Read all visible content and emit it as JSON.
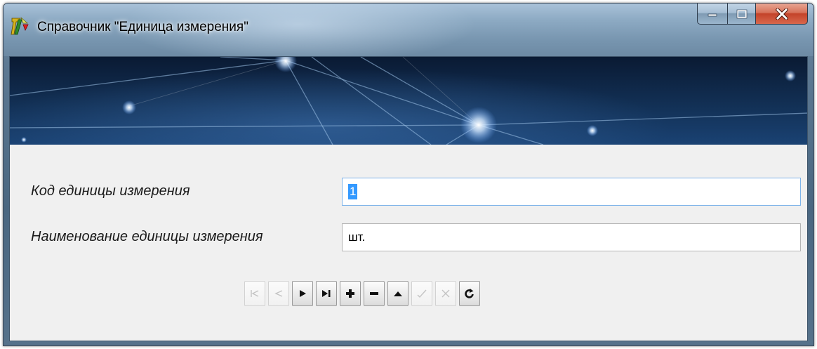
{
  "window": {
    "title": "Справочник \"Единица измерения\""
  },
  "form": {
    "code_label": "Код единицы измерения",
    "code_value": "1",
    "name_label": "Наименование единицы измерения",
    "name_value": "шт."
  },
  "navigator": {
    "buttons": [
      {
        "name": "first-record",
        "icon": "first-icon",
        "enabled": false
      },
      {
        "name": "prior-record",
        "icon": "prior-icon",
        "enabled": false
      },
      {
        "name": "next-record",
        "icon": "play-next-icon",
        "enabled": true
      },
      {
        "name": "last-record",
        "icon": "last-icon",
        "enabled": true
      },
      {
        "name": "insert-record",
        "icon": "plus-icon",
        "enabled": true
      },
      {
        "name": "delete-record",
        "icon": "minus-icon",
        "enabled": true
      },
      {
        "name": "edit-record",
        "icon": "triangle-up-icon",
        "enabled": true
      },
      {
        "name": "post-record",
        "icon": "check-icon",
        "enabled": false
      },
      {
        "name": "cancel-record",
        "icon": "cancel-x-icon",
        "enabled": false
      },
      {
        "name": "refresh-record",
        "icon": "refresh-icon",
        "enabled": true
      }
    ]
  },
  "colors": {
    "selection": "#3399ff",
    "client_bg": "#f0f0f0",
    "close_button": "#c3432a"
  }
}
